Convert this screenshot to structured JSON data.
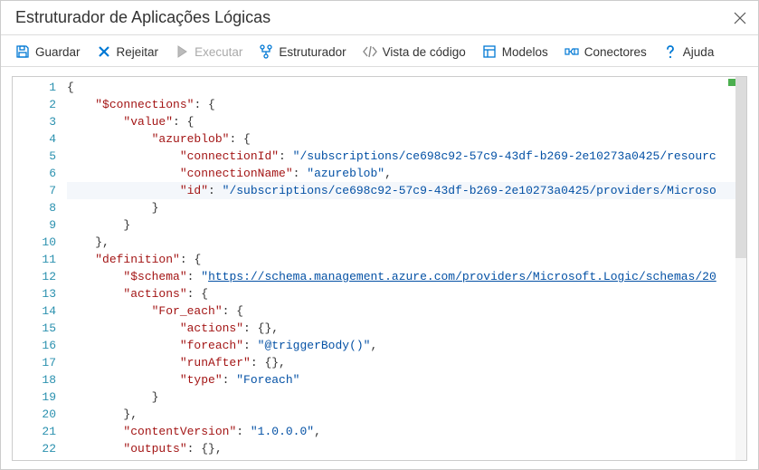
{
  "titlebar": {
    "title": "Estruturador de Aplicações Lógicas"
  },
  "toolbar": {
    "save": {
      "label": "Guardar"
    },
    "reject": {
      "label": "Rejeitar"
    },
    "run": {
      "label": "Executar"
    },
    "designer": {
      "label": "Estruturador"
    },
    "codeview": {
      "label": "Vista de código"
    },
    "models": {
      "label": "Modelos"
    },
    "connectors": {
      "label": "Conectores"
    },
    "help": {
      "label": "Ajuda"
    }
  },
  "code": {
    "line_count": 22,
    "highlighted_line": 7,
    "lines": [
      {
        "indent": 0,
        "tokens": [
          {
            "t": "{",
            "c": "punc"
          }
        ]
      },
      {
        "indent": 1,
        "tokens": [
          {
            "t": "\"$connections\"",
            "c": "key"
          },
          {
            "t": ": {",
            "c": "punc"
          }
        ]
      },
      {
        "indent": 2,
        "tokens": [
          {
            "t": "\"value\"",
            "c": "key"
          },
          {
            "t": ": {",
            "c": "punc"
          }
        ]
      },
      {
        "indent": 3,
        "tokens": [
          {
            "t": "\"azureblob\"",
            "c": "key"
          },
          {
            "t": ": {",
            "c": "punc"
          }
        ]
      },
      {
        "indent": 4,
        "tokens": [
          {
            "t": "\"connectionId\"",
            "c": "key"
          },
          {
            "t": ": ",
            "c": "punc"
          },
          {
            "t": "\"/subscriptions/ce698c92-57c9-43df-b269-2e10273a0425/resourc",
            "c": "str"
          }
        ]
      },
      {
        "indent": 4,
        "tokens": [
          {
            "t": "\"connectionName\"",
            "c": "key"
          },
          {
            "t": ": ",
            "c": "punc"
          },
          {
            "t": "\"azureblob\"",
            "c": "str"
          },
          {
            "t": ",",
            "c": "punc"
          }
        ]
      },
      {
        "indent": 4,
        "tokens": [
          {
            "t": "\"id\"",
            "c": "key"
          },
          {
            "t": ": ",
            "c": "punc"
          },
          {
            "t": "\"/subscriptions/ce698c92-57c9-43df-b269-2e10273a0425/providers/Microso",
            "c": "str"
          }
        ]
      },
      {
        "indent": 3,
        "tokens": [
          {
            "t": "}",
            "c": "punc"
          }
        ]
      },
      {
        "indent": 2,
        "tokens": [
          {
            "t": "}",
            "c": "punc"
          }
        ]
      },
      {
        "indent": 1,
        "tokens": [
          {
            "t": "},",
            "c": "punc"
          }
        ]
      },
      {
        "indent": 1,
        "tokens": [
          {
            "t": "\"definition\"",
            "c": "key"
          },
          {
            "t": ": {",
            "c": "punc"
          }
        ]
      },
      {
        "indent": 2,
        "tokens": [
          {
            "t": "\"$schema\"",
            "c": "key"
          },
          {
            "t": ": ",
            "c": "punc"
          },
          {
            "t": "\"",
            "c": "str"
          },
          {
            "t": "https://schema.management.azure.com/providers/Microsoft.Logic/schemas/20",
            "c": "link"
          }
        ]
      },
      {
        "indent": 2,
        "tokens": [
          {
            "t": "\"actions\"",
            "c": "key"
          },
          {
            "t": ": {",
            "c": "punc"
          }
        ]
      },
      {
        "indent": 3,
        "tokens": [
          {
            "t": "\"For_each\"",
            "c": "key"
          },
          {
            "t": ": {",
            "c": "punc"
          }
        ]
      },
      {
        "indent": 4,
        "tokens": [
          {
            "t": "\"actions\"",
            "c": "key"
          },
          {
            "t": ": {},",
            "c": "punc"
          }
        ]
      },
      {
        "indent": 4,
        "tokens": [
          {
            "t": "\"foreach\"",
            "c": "key"
          },
          {
            "t": ": ",
            "c": "punc"
          },
          {
            "t": "\"@triggerBody()\"",
            "c": "str"
          },
          {
            "t": ",",
            "c": "punc"
          }
        ]
      },
      {
        "indent": 4,
        "tokens": [
          {
            "t": "\"runAfter\"",
            "c": "key"
          },
          {
            "t": ": {},",
            "c": "punc"
          }
        ]
      },
      {
        "indent": 4,
        "tokens": [
          {
            "t": "\"type\"",
            "c": "key"
          },
          {
            "t": ": ",
            "c": "punc"
          },
          {
            "t": "\"Foreach\"",
            "c": "str"
          }
        ]
      },
      {
        "indent": 3,
        "tokens": [
          {
            "t": "}",
            "c": "punc"
          }
        ]
      },
      {
        "indent": 2,
        "tokens": [
          {
            "t": "},",
            "c": "punc"
          }
        ]
      },
      {
        "indent": 2,
        "tokens": [
          {
            "t": "\"contentVersion\"",
            "c": "key"
          },
          {
            "t": ": ",
            "c": "punc"
          },
          {
            "t": "\"1.0.0.0\"",
            "c": "str"
          },
          {
            "t": ",",
            "c": "punc"
          }
        ]
      },
      {
        "indent": 2,
        "tokens": [
          {
            "t": "\"outputs\"",
            "c": "key"
          },
          {
            "t": ": {},",
            "c": "punc"
          }
        ]
      }
    ]
  }
}
